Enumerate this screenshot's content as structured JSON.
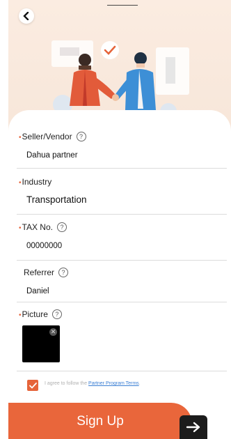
{
  "nav": {
    "back_icon": "chevron-left-icon"
  },
  "illustration": {
    "description_icon": "handshake-illustration"
  },
  "form": {
    "seller": {
      "label": "Seller/Vendor",
      "value": "Dahua partner",
      "required": true
    },
    "industry": {
      "label": "Industry",
      "value": "Transportation",
      "required": true
    },
    "tax": {
      "label": "TAX No.",
      "value": "00000000",
      "required": true
    },
    "referrer": {
      "label": "Referrer",
      "value": "Daniel",
      "required": false
    },
    "picture": {
      "label": "Picture",
      "required": true
    }
  },
  "help_glyph": "?",
  "agree": {
    "text": "I agree to follow the",
    "link": "Partner Program Terms",
    "suffix": ".",
    "checked": true
  },
  "signup": {
    "label": "Sign Up"
  },
  "colors": {
    "accent": "#e9663b",
    "hero_bg": "#fbece1",
    "link": "#3b7fd4"
  }
}
